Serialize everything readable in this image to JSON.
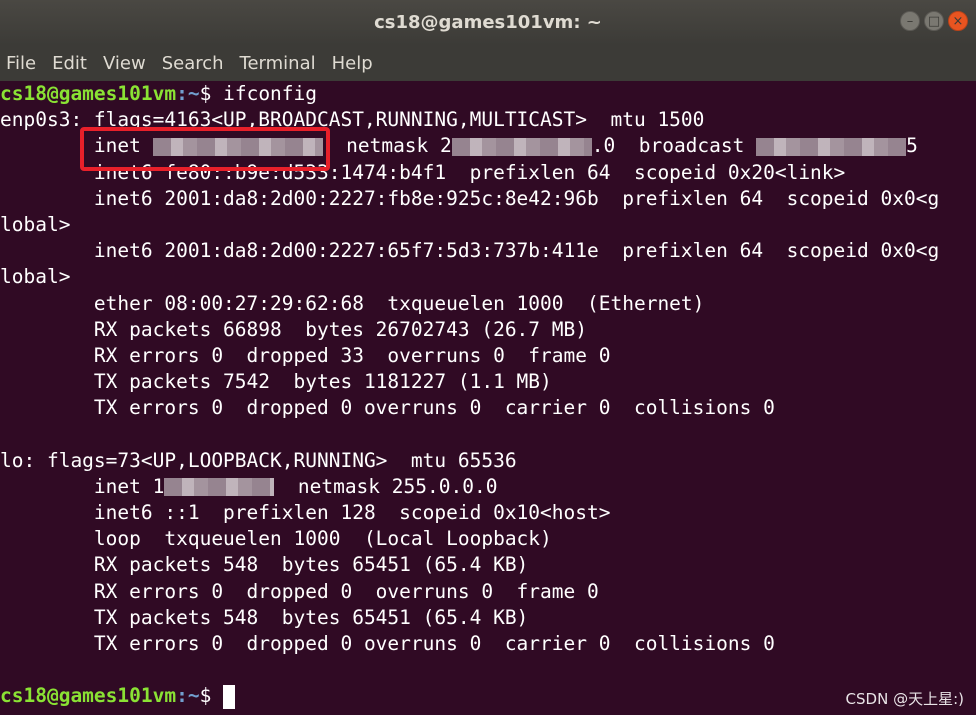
{
  "window": {
    "title": "cs18@games101vm: ~"
  },
  "menu": [
    "File",
    "Edit",
    "View",
    "Search",
    "Terminal",
    "Help"
  ],
  "prompt": {
    "user": "cs18@games101vm",
    "path": ":~",
    "symbol": "$"
  },
  "command": "ifconfig",
  "output": {
    "enp": {
      "l1": "enp0s3: flags=4163<UP,BROADCAST,RUNNING,MULTICAST>  mtu 1500",
      "inet_prefix": "        inet ",
      "netmask_label": "  netmask 2",
      "netmask_suffix": ".0  broadcast ",
      "broadcast_suffix": "5",
      "l3": "        inet6 fe80::b9e:d533:1474:b4f1  prefixlen 64  scopeid 0x20<link>",
      "l4": "        inet6 2001:da8:2d00:2227:fb8e:925c:8e42:96b  prefixlen 64  scopeid 0x0<g",
      "l5": "lobal>",
      "l6": "        inet6 2001:da8:2d00:2227:65f7:5d3:737b:411e  prefixlen 64  scopeid 0x0<g",
      "l7": "lobal>",
      "l8": "        ether 08:00:27:29:62:68  txqueuelen 1000  (Ethernet)",
      "l9": "        RX packets 66898  bytes 26702743 (26.7 MB)",
      "l10": "        RX errors 0  dropped 33  overruns 0  frame 0",
      "l11": "        TX packets 7542  bytes 1181227 (1.1 MB)",
      "l12": "        TX errors 0  dropped 0 overruns 0  carrier 0  collisions 0"
    },
    "lo": {
      "l1": "lo: flags=73<UP,LOOPBACK,RUNNING>  mtu 65536",
      "inet_prefix": "        inet 1",
      "netmask": "  netmask 255.0.0.0",
      "l3": "        inet6 ::1  prefixlen 128  scopeid 0x10<host>",
      "l4": "        loop  txqueuelen 1000  (Local Loopback)",
      "l5": "        RX packets 548  bytes 65451 (65.4 KB)",
      "l6": "        RX errors 0  dropped 0  overruns 0  frame 0",
      "l7": "        TX packets 548  bytes 65451 (65.4 KB)",
      "l8": "        TX errors 0  dropped 0 overruns 0  carrier 0  collisions 0"
    }
  },
  "watermark": "CSDN @天上星:)",
  "colors": {
    "background": "#300a24",
    "prompt_user": "#8ae234",
    "prompt_path": "#729fcf",
    "highlight": "#e8202a"
  }
}
